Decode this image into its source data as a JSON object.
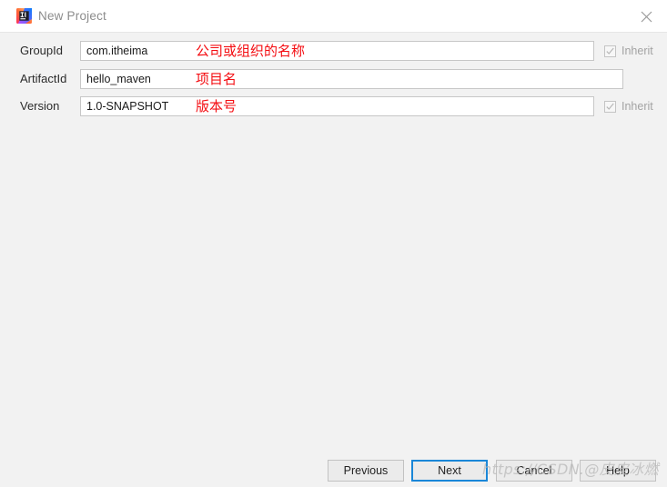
{
  "window": {
    "title": "New Project",
    "icon": "intellij-idea-logo-icon",
    "close_label": "✕"
  },
  "form": {
    "rows": [
      {
        "label": "GroupId",
        "value": "com.itheima",
        "annotation": "公司或组织的名称",
        "has_inherit": true,
        "inherit_label": "Inherit",
        "inherit_checked": true,
        "inherit_enabled": false
      },
      {
        "label": "ArtifactId",
        "value": "hello_maven",
        "annotation": "项目名",
        "has_inherit": false,
        "inherit_label": "",
        "inherit_checked": false,
        "inherit_enabled": false
      },
      {
        "label": "Version",
        "value": "1.0-SNAPSHOT",
        "annotation": "版本号",
        "has_inherit": true,
        "inherit_label": "Inherit",
        "inherit_checked": true,
        "inherit_enabled": false
      }
    ]
  },
  "buttons": {
    "previous": "Previous",
    "next": "Next",
    "cancel": "Cancel",
    "help": "Help",
    "default_focus": "next"
  },
  "watermark": {
    "text": "https://CSDN.@皮皮冰燃"
  },
  "colors": {
    "dialog_background": "#f2f2f2",
    "titlebar_background": "#ffffff",
    "field_background": "#ffffff",
    "field_border": "#c7c7c7",
    "annotation_red": "#f40d12",
    "focus_blue": "#1a87d8",
    "label_text": "#2b2b2b",
    "title_text": "#8c8c8c",
    "disabled_text": "#a3a3a3",
    "watermark_gray": "#b9b9b9"
  }
}
